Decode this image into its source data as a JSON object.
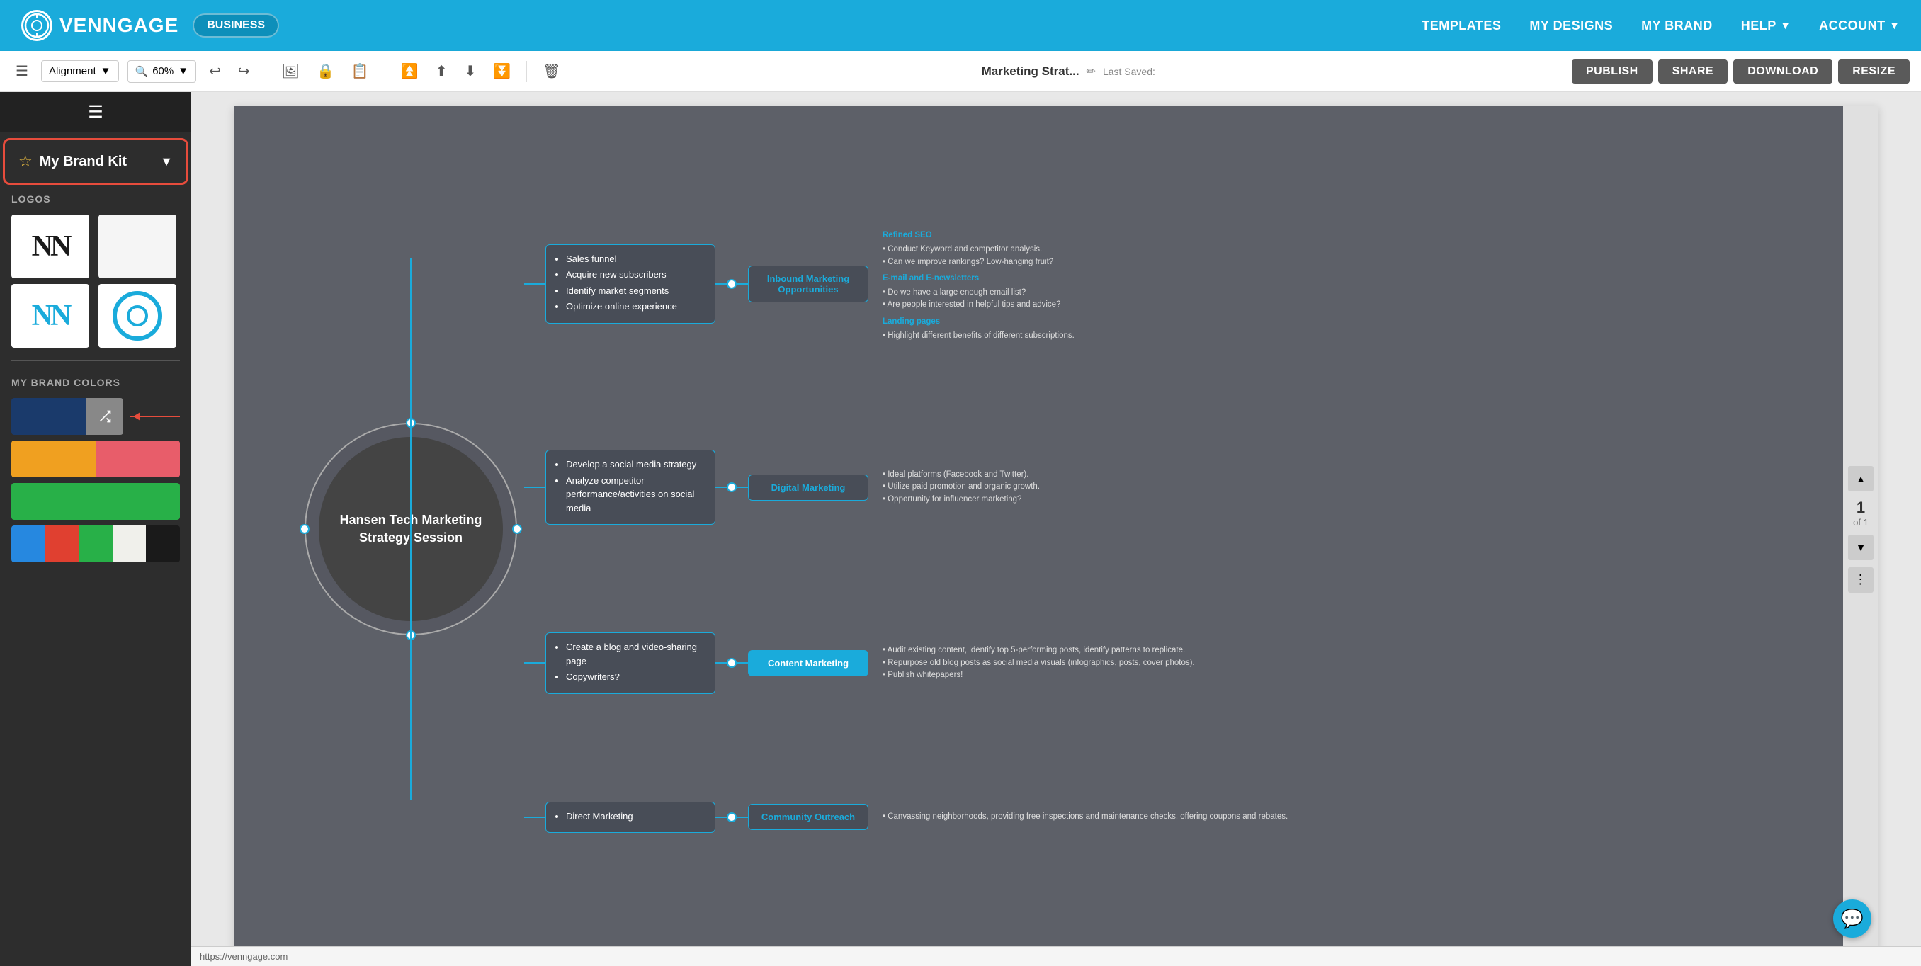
{
  "app": {
    "name": "VENNGAGE",
    "badge": "BUSINESS",
    "logo_icon": "clock-circle"
  },
  "nav": {
    "links": [
      "TEMPLATES",
      "MY DESIGNS",
      "MY BRAND",
      "HELP",
      "ACCOUNT"
    ],
    "dropdown_links": [
      "HELP",
      "ACCOUNT"
    ]
  },
  "toolbar": {
    "alignment_label": "Alignment",
    "zoom_label": "60%",
    "doc_title": "Marketing Strat...",
    "last_saved_label": "Last Saved:",
    "publish_label": "PUBLISH",
    "share_label": "SHARE",
    "download_label": "DOWNLOAD",
    "resize_label": "RESIZE"
  },
  "sidebar": {
    "brand_kit_label": "My Brand Kit",
    "logos_label": "LOGOS",
    "brand_colors_label": "MY BRAND COLORS",
    "logos": [
      {
        "id": "logo-nn-black",
        "type": "text",
        "text": "NN"
      },
      {
        "id": "logo-blank",
        "type": "blank"
      },
      {
        "id": "logo-nn-blue",
        "type": "text-blue",
        "text": "NN"
      },
      {
        "id": "logo-circle-blue",
        "type": "circle"
      }
    ],
    "color_rows": [
      {
        "colors": [
          "#1a3a6b",
          "#888888"
        ],
        "has_shuffle": true
      },
      {
        "colors": [
          "#f0a020",
          "#e85d6a"
        ]
      },
      {
        "colors": [
          "#28b048"
        ]
      },
      {
        "colors": [
          "#2688e0",
          "#e04030",
          "#28b048",
          "#f5f5f0",
          "#1a1a1a"
        ]
      }
    ]
  },
  "diagram": {
    "center_title": "Hansen Tech Marketing Strategy Session",
    "rows": [
      {
        "left_items": [
          "Sales funnel",
          "Acquire new subscribers",
          "Identify market segments",
          "Optimize online experience"
        ],
        "right_label": "Inbound Marketing Opportunities",
        "highlight": false,
        "far_right": {
          "sections": [
            {
              "heading": "Refined SEO",
              "bullets": [
                "Conduct Keyword and competitor analysis.",
                "Can we improve rankings? Low-hanging fruit?"
              ]
            },
            {
              "heading": "E-mail and E-newsletters",
              "bullets": [
                "Do we have a large enough email list?",
                "Are people interested in helpful tips and advice?"
              ]
            },
            {
              "heading": "Landing pages",
              "bullets": [
                "Highlight different benefits of different subscriptions."
              ]
            }
          ]
        }
      },
      {
        "left_items": [
          "Develop a social media strategy",
          "Analyze competitor performance/activities on social media"
        ],
        "right_label": "Digital Marketing",
        "highlight": false,
        "far_right": {
          "sections": [
            {
              "heading": "",
              "bullets": [
                "Ideal platforms (Facebook and Twitter).",
                "Utilize paid promotion and organic growth.",
                "Opportunity for influencer marketing?"
              ]
            }
          ]
        }
      },
      {
        "left_items": [
          "Create a blog and video-sharing page",
          "Copywriters?"
        ],
        "right_label": "Content Marketing",
        "highlight": true,
        "far_right": {
          "sections": [
            {
              "heading": "",
              "bullets": [
                "Audit existing content, identify top 5-performing posts, identify patterns to replicate.",
                "Repurpose old blog posts as social media visuals (infographics, posts, cover photos).",
                "Publish whitepapers!"
              ]
            }
          ]
        }
      },
      {
        "left_items": [
          "Direct Marketing"
        ],
        "right_label": "Community Outreach",
        "highlight": false,
        "far_right": {
          "sections": [
            {
              "heading": "",
              "bullets": [
                "Canvassing neighborhoods, providing free inspections and maintenance checks, offering coupons and rebates."
              ]
            }
          ]
        }
      }
    ]
  },
  "pagination": {
    "current": "1",
    "of_label": "of 1"
  },
  "status_bar": {
    "url": "https://venngage.com"
  },
  "chat": {
    "icon": "💬"
  }
}
